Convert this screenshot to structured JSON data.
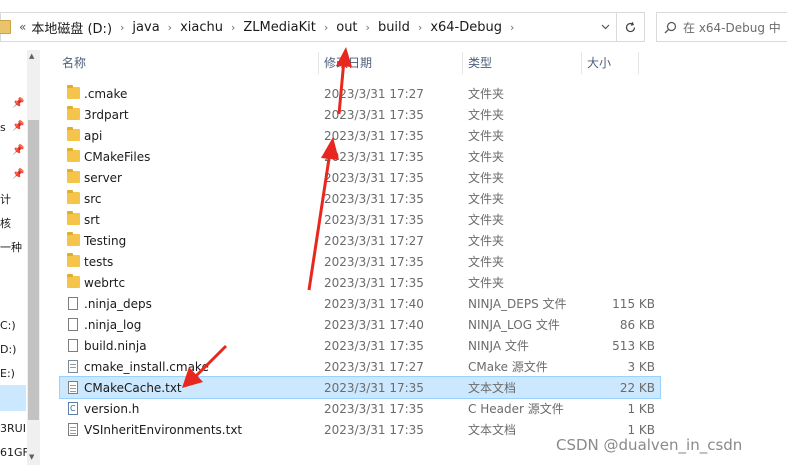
{
  "address": {
    "prefix": "«",
    "crumbs": [
      "本地磁盘 (D:)",
      "java",
      "xiachu",
      "ZLMediaKit",
      "out",
      "build",
      "x64-Debug"
    ]
  },
  "search": {
    "placeholder": "在 x64-Debug 中"
  },
  "nav": {
    "items": [
      {
        "label": "s"
      },
      {
        "label": "计"
      },
      {
        "label": "核"
      },
      {
        "label": "一种"
      },
      {
        "label": "C:)"
      },
      {
        "label": "D:)"
      },
      {
        "label": "E:)"
      },
      {
        "label": "3RUI"
      },
      {
        "label": "61GF"
      }
    ]
  },
  "columns": {
    "name": "名称",
    "date": "修改日期",
    "type": "类型",
    "size": "大小"
  },
  "files": [
    {
      "name": ".cmake",
      "date": "2023/3/31 17:27",
      "type": "文件夹",
      "size": "",
      "kind": "folder"
    },
    {
      "name": "3rdpart",
      "date": "2023/3/31 17:35",
      "type": "文件夹",
      "size": "",
      "kind": "folder"
    },
    {
      "name": "api",
      "date": "2023/3/31 17:35",
      "type": "文件夹",
      "size": "",
      "kind": "folder"
    },
    {
      "name": "CMakeFiles",
      "date": "2023/3/31 17:35",
      "type": "文件夹",
      "size": "",
      "kind": "folder"
    },
    {
      "name": "server",
      "date": "2023/3/31 17:35",
      "type": "文件夹",
      "size": "",
      "kind": "folder"
    },
    {
      "name": "src",
      "date": "2023/3/31 17:35",
      "type": "文件夹",
      "size": "",
      "kind": "folder"
    },
    {
      "name": "srt",
      "date": "2023/3/31 17:35",
      "type": "文件夹",
      "size": "",
      "kind": "folder"
    },
    {
      "name": "Testing",
      "date": "2023/3/31 17:27",
      "type": "文件夹",
      "size": "",
      "kind": "folder"
    },
    {
      "name": "tests",
      "date": "2023/3/31 17:35",
      "type": "文件夹",
      "size": "",
      "kind": "folder"
    },
    {
      "name": "webrtc",
      "date": "2023/3/31 17:35",
      "type": "文件夹",
      "size": "",
      "kind": "folder"
    },
    {
      "name": ".ninja_deps",
      "date": "2023/3/31 17:40",
      "type": "NINJA_DEPS 文件",
      "size": "115 KB",
      "kind": "file"
    },
    {
      "name": ".ninja_log",
      "date": "2023/3/31 17:40",
      "type": "NINJA_LOG 文件",
      "size": "86 KB",
      "kind": "file"
    },
    {
      "name": "build.ninja",
      "date": "2023/3/31 17:35",
      "type": "NINJA 文件",
      "size": "513 KB",
      "kind": "file"
    },
    {
      "name": "cmake_install.cmake",
      "date": "2023/3/31 17:27",
      "type": "CMake 源文件",
      "size": "3 KB",
      "kind": "cmake"
    },
    {
      "name": "CMakeCache.txt",
      "date": "2023/3/31 17:35",
      "type": "文本文档",
      "size": "22 KB",
      "kind": "text",
      "selected": true
    },
    {
      "name": "version.h",
      "date": "2023/3/31 17:35",
      "type": "C Header 源文件",
      "size": "1 KB",
      "kind": "header"
    },
    {
      "name": "VSInheritEnvironments.txt",
      "date": "2023/3/31 17:35",
      "type": "文本文档",
      "size": "1 KB",
      "kind": "text"
    }
  ],
  "watermark": "CSDN @dualven_in_csdn",
  "colors": {
    "selection": "#cce8ff",
    "folder": "#f4c54a",
    "arrow": "#e8281e"
  }
}
